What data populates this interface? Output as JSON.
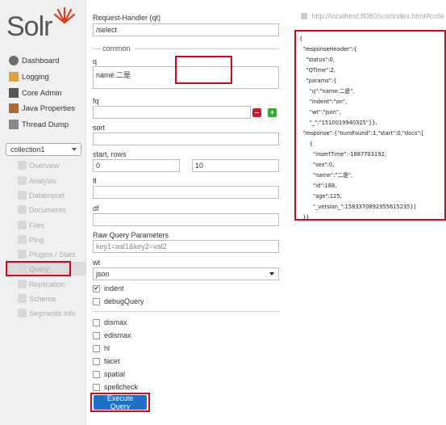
{
  "logo": {
    "text": "Solr"
  },
  "nav": [
    {
      "label": "Dashboard",
      "icon": "dashboard-icon"
    },
    {
      "label": "Logging",
      "icon": "logging-icon"
    },
    {
      "label": "Core Admin",
      "icon": "core-admin-icon"
    },
    {
      "label": "Java Properties",
      "icon": "java-properties-icon"
    },
    {
      "label": "Thread Dump",
      "icon": "thread-dump-icon"
    }
  ],
  "core_selector": {
    "value": "collection1"
  },
  "core_menu": [
    {
      "label": "Overview"
    },
    {
      "label": "Analysis"
    },
    {
      "label": "Dataimport"
    },
    {
      "label": "Documents"
    },
    {
      "label": "Files"
    },
    {
      "label": "Ping"
    },
    {
      "label": "Plugins / Stats"
    },
    {
      "label": "Query"
    },
    {
      "label": "Replication"
    },
    {
      "label": "Schema"
    },
    {
      "label": "Segments info"
    }
  ],
  "form": {
    "request_handler_label": "Request-Handler (qt)",
    "request_handler_value": "/select",
    "common_label": "common",
    "q_label": "q",
    "q_value": "name:二是",
    "fq_label": "fq",
    "sort_label": "sort",
    "start_rows_label": "start, rows",
    "start_value": "0",
    "rows_value": "10",
    "fl_label": "fl",
    "df_label": "df",
    "raw_label": "Raw Query Parameters",
    "raw_placeholder": "key1=val1&key2=val2",
    "wt_label": "wt",
    "wt_value": "json",
    "indent_label": "indent",
    "debug_label": "debugQuery",
    "dismax_label": "dismax",
    "edismax_label": "edismax",
    "hl_label": "hl",
    "facet_label": "facet",
    "spatial_label": "spatial",
    "spellcheck_label": "spellcheck",
    "execute_label": "Execute Query"
  },
  "results": {
    "url": "http://localhost:8080/solr/index.html#colle",
    "json_lines": [
      "{",
      "  \"responseHeader\":{",
      "    \"status\":0,",
      "    \"QTime\":2,",
      "    \"params\":{",
      "      \"q\":\"name:二是\",",
      "      \"indent\":\"on\",",
      "      \"wt\":\"json\",",
      "      \"_\":\"1510019940325\"}},",
      "  \"response\":{\"numFound\":1,\"start\":0,\"docs\":[",
      "      {",
      "        \"insertTime\":-1887703192,",
      "        \"sex\":0,",
      "        \"name\":\"二是\",",
      "        \"id\":188,",
      "        \"age\":125,",
      "        \"_version_\":1583370892955615235}]",
      "  }}"
    ]
  }
}
